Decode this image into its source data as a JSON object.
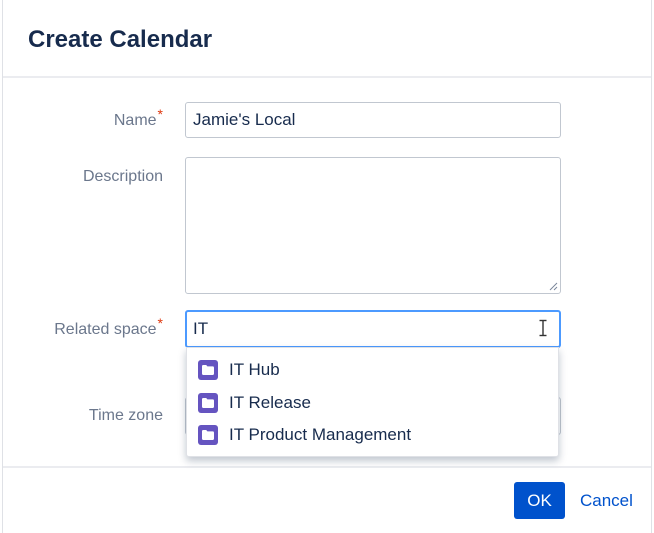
{
  "dialog": {
    "title": "Create Calendar"
  },
  "form": {
    "name": {
      "label": "Name",
      "required_mark": "*",
      "value": "Jamie's Local"
    },
    "description": {
      "label": "Description",
      "value": ""
    },
    "related_space": {
      "label": "Related space",
      "required_mark": "*",
      "value": "IT"
    },
    "time_zone": {
      "label": "Time zone"
    }
  },
  "space_suggestions": [
    {
      "label": "IT Hub",
      "icon": "folder-icon"
    },
    {
      "label": "IT Release",
      "icon": "folder-icon"
    },
    {
      "label": "IT Product Management",
      "icon": "folder-icon"
    }
  ],
  "buttons": {
    "ok": "OK",
    "cancel": "Cancel"
  },
  "colors": {
    "primary": "#0052cc",
    "space_icon": "#6554c0",
    "required": "#de350b",
    "focus_border": "#4c9aff",
    "title_text": "#172b4d"
  }
}
